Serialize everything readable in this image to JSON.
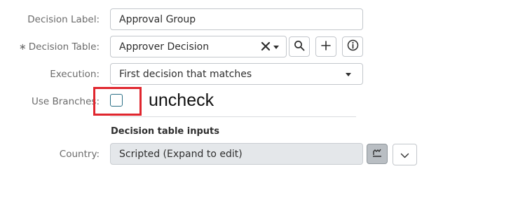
{
  "form": {
    "decision_label": {
      "label": "Decision Label:",
      "value": "Approval Group"
    },
    "decision_table": {
      "required_mark": "∗",
      "label": "Decision Table:",
      "value": "Approver Decision"
    },
    "execution": {
      "label": "Execution:",
      "value": "First decision that matches"
    },
    "use_branches": {
      "label": "Use Branches:",
      "checked": false
    },
    "section_title": "Decision table inputs",
    "country": {
      "label": "Country:",
      "value": "Scripted (Expand to edit)"
    }
  },
  "annotation": {
    "text": "uncheck",
    "color": "#e0262e"
  },
  "icons": {
    "clear": "clear-x-icon",
    "search": "search-icon",
    "add": "plus-icon",
    "info": "info-icon",
    "script": "script-edit-icon",
    "expand": "chevron-down-icon"
  }
}
